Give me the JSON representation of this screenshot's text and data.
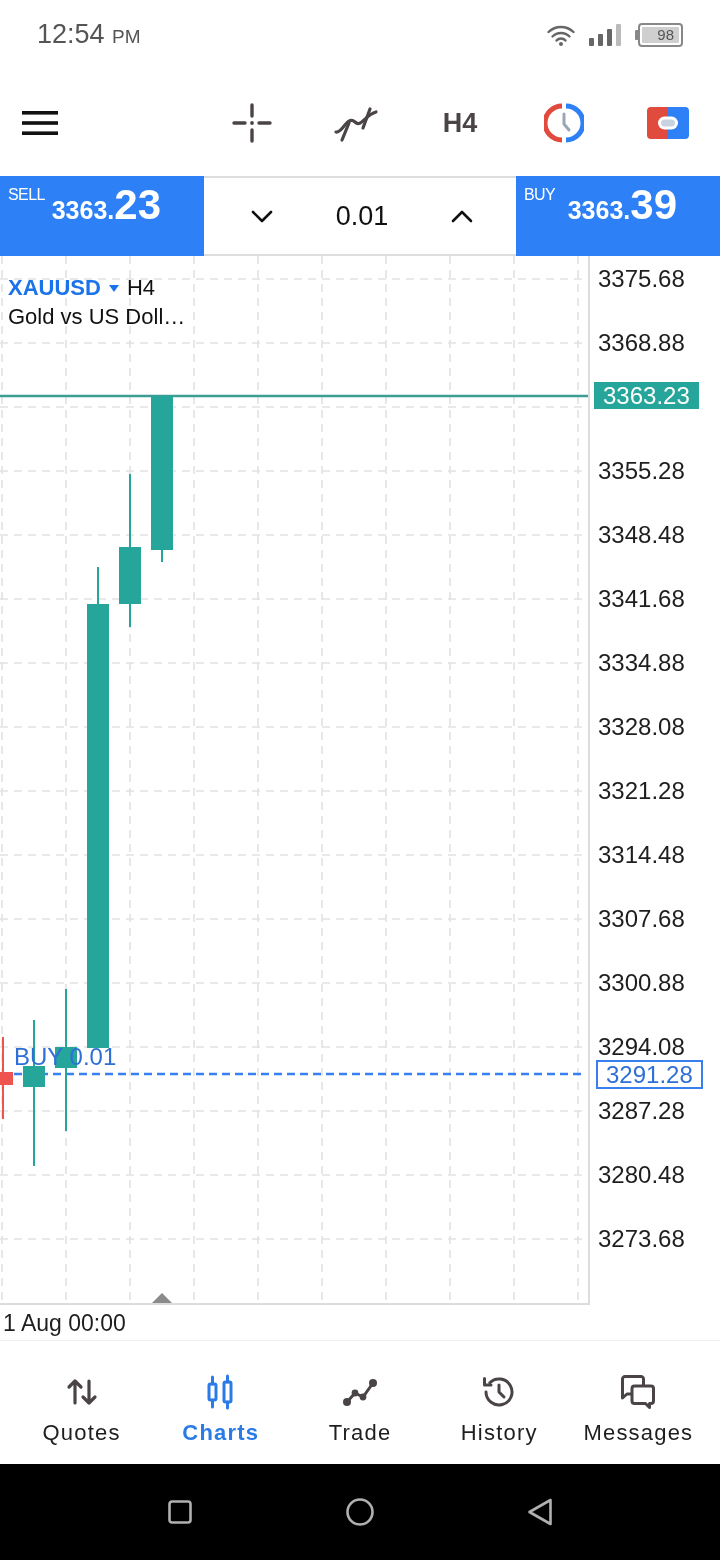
{
  "status_bar": {
    "time": "12:54",
    "time_suffix": "PM",
    "battery": "98"
  },
  "toolbar": {
    "timeframe": "H4"
  },
  "trade_panel": {
    "sell": {
      "label": "SELL",
      "price_head": "3363.",
      "price_tail": "23"
    },
    "volume": "0.01",
    "buy": {
      "label": "BUY",
      "price_head": "3363.",
      "price_tail": "39"
    }
  },
  "chart": {
    "symbol": "XAUUSD",
    "timeframe": "H4",
    "description": "Gold vs US Doll…",
    "position": {
      "label": "BUY 0.01",
      "price": "3291.28"
    },
    "price_axis": [
      {
        "kind": "tick",
        "text": "3375.68"
      },
      {
        "kind": "tick",
        "text": "3368.88"
      },
      {
        "kind": "current",
        "text": "3363.23"
      },
      {
        "kind": "tick",
        "text": "3355.28"
      },
      {
        "kind": "tick",
        "text": "3348.48"
      },
      {
        "kind": "tick",
        "text": "3341.68"
      },
      {
        "kind": "tick",
        "text": "3334.88"
      },
      {
        "kind": "tick",
        "text": "3328.08"
      },
      {
        "kind": "tick",
        "text": "3321.28"
      },
      {
        "kind": "tick",
        "text": "3314.48"
      },
      {
        "kind": "tick",
        "text": "3307.68"
      },
      {
        "kind": "tick",
        "text": "3300.88"
      },
      {
        "kind": "tick",
        "text": "3294.08"
      },
      {
        "kind": "tick",
        "text": "3287.28"
      },
      {
        "kind": "tick",
        "text": "3280.48"
      },
      {
        "kind": "tick",
        "text": "3273.68"
      }
    ],
    "time_label": "1 Aug 00:00"
  },
  "bottom_nav": [
    {
      "label": "Quotes",
      "selected": false
    },
    {
      "label": "Charts",
      "selected": true
    },
    {
      "label": "Trade",
      "selected": false
    },
    {
      "label": "History",
      "selected": false
    },
    {
      "label": "Messages",
      "selected": false
    }
  ]
}
